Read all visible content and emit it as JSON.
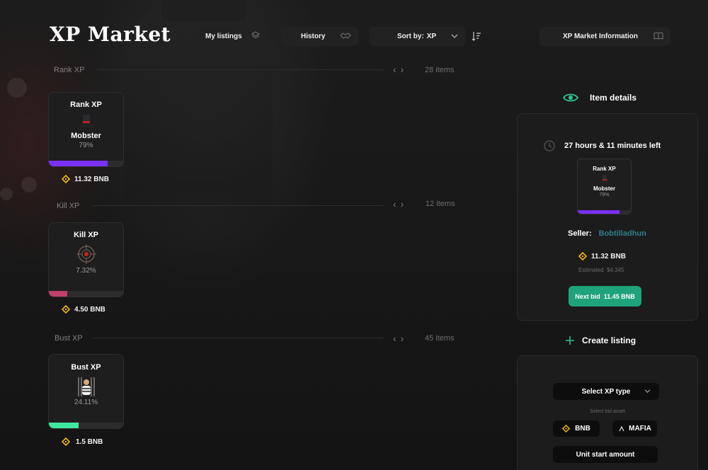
{
  "app": {
    "title": "XP Market"
  },
  "toolbar": {
    "my_listings": "My listings",
    "history": "History",
    "sort_label": "Sort by:",
    "sort_value": "XP",
    "info": "XP Market Information"
  },
  "sections": [
    {
      "label": "Rank XP",
      "count": "28 items",
      "card": {
        "title": "Rank XP",
        "icon": "top-hat-icon",
        "name": "Mobster",
        "pct": "79%",
        "fill": 0.79,
        "fill_color": "#7b2ff7"
      },
      "price": "11.32 BNB"
    },
    {
      "label": "Kill XP",
      "count": "12 items",
      "card": {
        "title": "Kill XP",
        "icon": "crosshair-icon",
        "name": "",
        "pct": "7.32%",
        "fill": 0.2432,
        "fill_color": "#c0406a"
      },
      "price": "4.50 BNB"
    },
    {
      "label": "Bust XP",
      "count": "45 items",
      "card": {
        "title": "Bust XP",
        "icon": "prisoner-icon",
        "name": "",
        "pct": "24.11%",
        "fill": 0.4,
        "fill_color": "#3fe8a0"
      },
      "price": "1.5 BNB"
    }
  ],
  "details": {
    "heading": "Item details",
    "time_left": "27 hours & 11 minutes left",
    "card": {
      "title": "Rank XP",
      "name": "Mobster",
      "pct": "79%",
      "fill": 0.79
    },
    "seller_label": "Seller:",
    "seller_name": "Bobtilladhun",
    "price": "11.32 BNB",
    "estimated": "Estimated  $4,345",
    "next_bid": "Next bid  11.45 BNB"
  },
  "create": {
    "heading": "Create listing",
    "select_type": "Select XP type",
    "bid_asset_label": "Select bid asset",
    "asset_bnb": "BNB",
    "asset_mafia": "MAFIA",
    "unit_start": "Unit start amount"
  },
  "colors": {
    "accent_green": "#1fa37a",
    "bnb_gold": "#f0b90b",
    "seller_teal": "#2f7f8f"
  }
}
